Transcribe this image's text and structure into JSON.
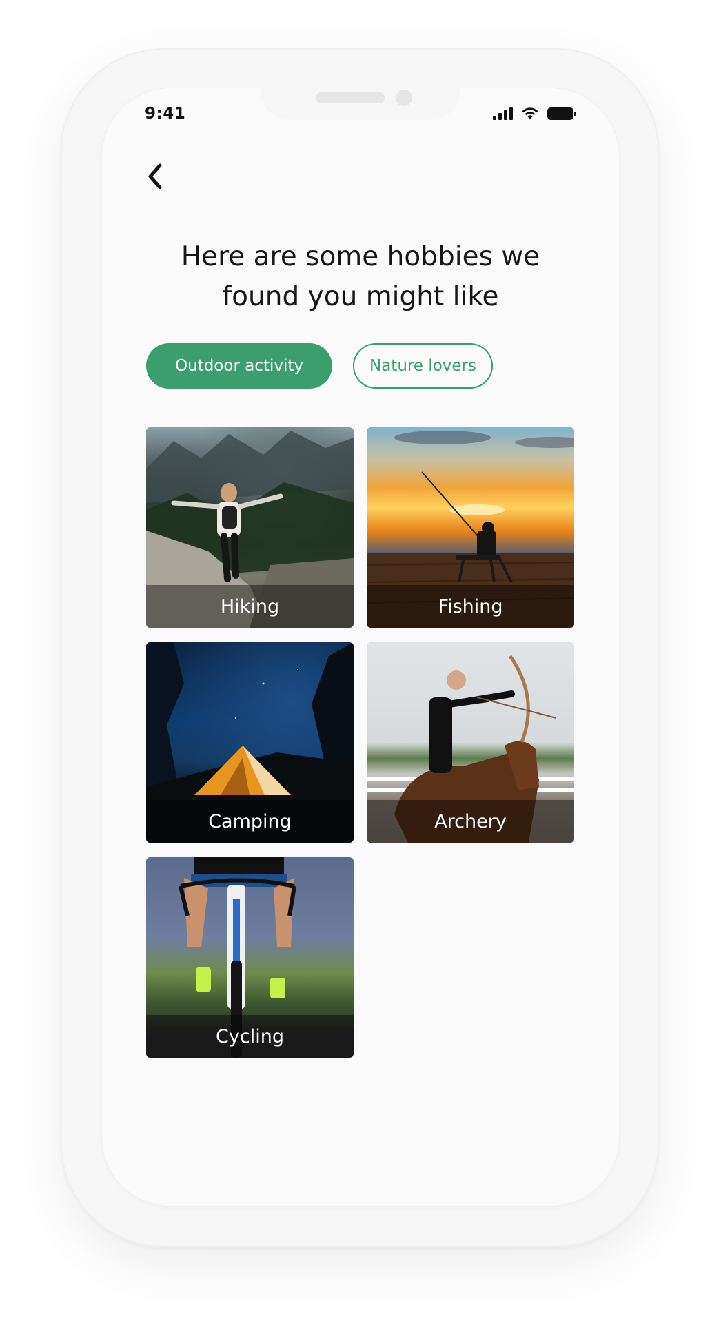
{
  "status_bar": {
    "time": "9:41"
  },
  "nav": {
    "back_icon": "chevron-left-icon"
  },
  "header": {
    "title_line1": "Here are some hobbies we",
    "title_line2": "found you might like"
  },
  "tags": [
    {
      "label": "Outdoor activity",
      "selected": true
    },
    {
      "label": "Nature lovers",
      "selected": false
    }
  ],
  "hobbies": [
    {
      "label": "Hiking"
    },
    {
      "label": "Fishing"
    },
    {
      "label": "Camping"
    },
    {
      "label": "Archery"
    },
    {
      "label": "Cycling"
    }
  ],
  "colors": {
    "accent": "#3a9e6e",
    "background": "#fafafa",
    "text": "#161616"
  }
}
